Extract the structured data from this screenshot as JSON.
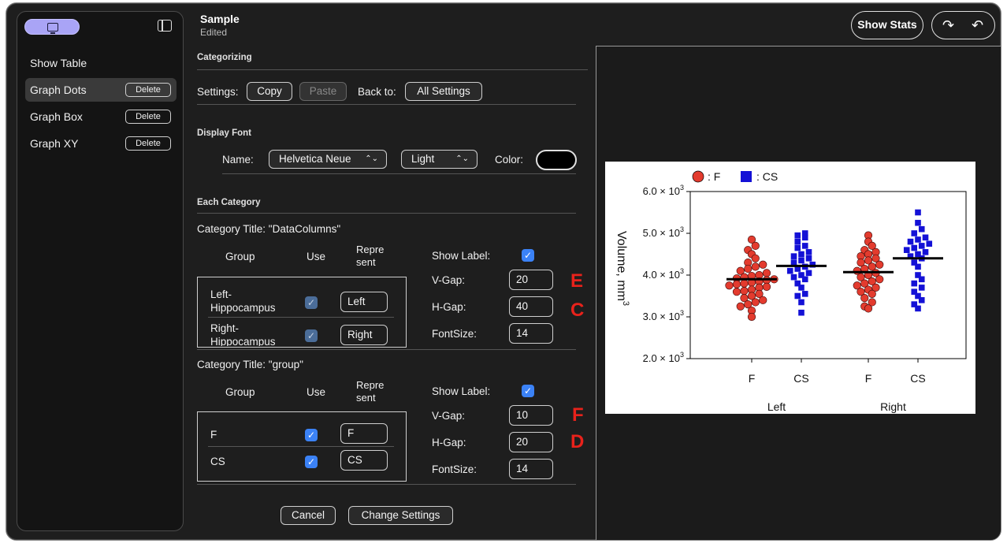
{
  "sidebar": {
    "items": [
      {
        "label": "Show Table",
        "has_delete": false,
        "selected": false
      },
      {
        "label": "Graph Dots",
        "has_delete": true,
        "selected": true
      },
      {
        "label": "Graph Box",
        "has_delete": true,
        "selected": false
      },
      {
        "label": "Graph XY",
        "has_delete": true,
        "selected": false
      }
    ],
    "delete_label": "Delete",
    "accent_color": "#a9a4f6"
  },
  "header": {
    "title": "Sample",
    "subtitle": "Edited",
    "show_stats_label": "Show Stats"
  },
  "settings": {
    "section_categorizing": "Categorizing",
    "settings_label": "Settings:",
    "copy_label": "Copy",
    "paste_label": "Paste",
    "back_to_label": "Back to:",
    "all_settings_label": "All Settings",
    "section_display_font": "Display Font",
    "name_label": "Name:",
    "font_name": "Helvetica Neue",
    "font_weight": "Light",
    "color_label": "Color:",
    "font_color": "#000000",
    "section_each_category": "Each Category",
    "categories": [
      {
        "title": "Category Title: \"DataColumns\"",
        "col_group": "Group",
        "col_use": "Use",
        "col_represent_1": "Repre",
        "col_represent_2": "sent",
        "rows": [
          {
            "group_1": "Left-",
            "group_2": "Hippocampus",
            "use": true,
            "represent": "Left"
          },
          {
            "group_1": "Right-",
            "group_2": "Hippocampus",
            "use": true,
            "represent": "Right"
          }
        ],
        "show_label_text": "Show Label:",
        "show_label": true,
        "vgap_label": "V-Gap:",
        "vgap": "20",
        "hgap_label": "H-Gap:",
        "hgap": "40",
        "fontsize_label": "FontSize:",
        "fontsize": "14"
      },
      {
        "title": "Category Title: \"group\"",
        "col_group": "Group",
        "col_use": "Use",
        "col_represent_1": "Repre",
        "col_represent_2": "sent",
        "rows": [
          {
            "group_1": "F",
            "group_2": "",
            "use": true,
            "represent": "F"
          },
          {
            "group_1": "CS",
            "group_2": "",
            "use": true,
            "represent": "CS"
          }
        ],
        "show_label_text": "Show Label:",
        "show_label": true,
        "vgap_label": "V-Gap:",
        "vgap": "10",
        "hgap_label": "H-Gap:",
        "hgap": "20",
        "fontsize_label": "FontSize:",
        "fontsize": "14"
      }
    ],
    "annotations": [
      "E",
      "C",
      "F",
      "D"
    ],
    "cancel_label": "Cancel",
    "change_settings_label": "Change Settings"
  },
  "chart_data": {
    "type": "scatter",
    "ylabel": "Volume, mm",
    "ylabel_sup": "3",
    "ylim": [
      2000,
      6000
    ],
    "yticks": [
      {
        "value": 2000,
        "mant": "2.0",
        "exp": "3"
      },
      {
        "value": 3000,
        "mant": "3.0",
        "exp": "3"
      },
      {
        "value": 4000,
        "mant": "4.0",
        "exp": "3"
      },
      {
        "value": 5000,
        "mant": "5.0",
        "exp": "3"
      },
      {
        "value": 6000,
        "mant": "6.0",
        "exp": "3"
      }
    ],
    "tick_times": "× 10",
    "legend": [
      {
        "name": ": F",
        "color": "#e33b2e",
        "marker": "circle"
      },
      {
        "name": ": CS",
        "color": "#1411d6",
        "marker": "square"
      }
    ],
    "groups": [
      {
        "label": "Left",
        "categories": [
          "F",
          "CS"
        ]
      },
      {
        "label": "Right",
        "categories": [
          "F",
          "CS"
        ]
      }
    ],
    "series": [
      {
        "group": "Left",
        "category": "F",
        "marker": "circle",
        "color": "#e33b2e",
        "mean": 3900,
        "values": [
          3000,
          3150,
          3250,
          3300,
          3350,
          3400,
          3450,
          3500,
          3550,
          3600,
          3620,
          3650,
          3700,
          3720,
          3750,
          3780,
          3800,
          3820,
          3850,
          3880,
          3900,
          3920,
          3950,
          3980,
          4000,
          4050,
          4100,
          4150,
          4200,
          4250,
          4300,
          4400,
          4500,
          4600,
          4700,
          4850
        ]
      },
      {
        "group": "Left",
        "category": "CS",
        "marker": "square",
        "color": "#1411d6",
        "mean": 4220,
        "values": [
          3100,
          3350,
          3500,
          3550,
          3700,
          3800,
          3900,
          3950,
          4000,
          4050,
          4100,
          4150,
          4200,
          4250,
          4300,
          4350,
          4400,
          4450,
          4500,
          4550,
          4650,
          4700,
          4800,
          4900,
          4950,
          5000
        ]
      },
      {
        "group": "Right",
        "category": "F",
        "marker": "circle",
        "color": "#e33b2e",
        "mean": 4070,
        "values": [
          3200,
          3250,
          3350,
          3450,
          3550,
          3600,
          3650,
          3700,
          3750,
          3800,
          3850,
          3900,
          3950,
          4000,
          4050,
          4100,
          4150,
          4200,
          4250,
          4300,
          4350,
          4400,
          4450,
          4500,
          4550,
          4600,
          4700,
          4800,
          4950
        ]
      },
      {
        "group": "Right",
        "category": "CS",
        "marker": "square",
        "color": "#1411d6",
        "mean": 4400,
        "values": [
          3200,
          3300,
          3400,
          3500,
          3600,
          3700,
          3800,
          3900,
          4000,
          4200,
          4300,
          4400,
          4450,
          4500,
          4550,
          4600,
          4650,
          4700,
          4750,
          4800,
          4850,
          4900,
          5000,
          5100,
          5250,
          5500
        ]
      }
    ]
  }
}
